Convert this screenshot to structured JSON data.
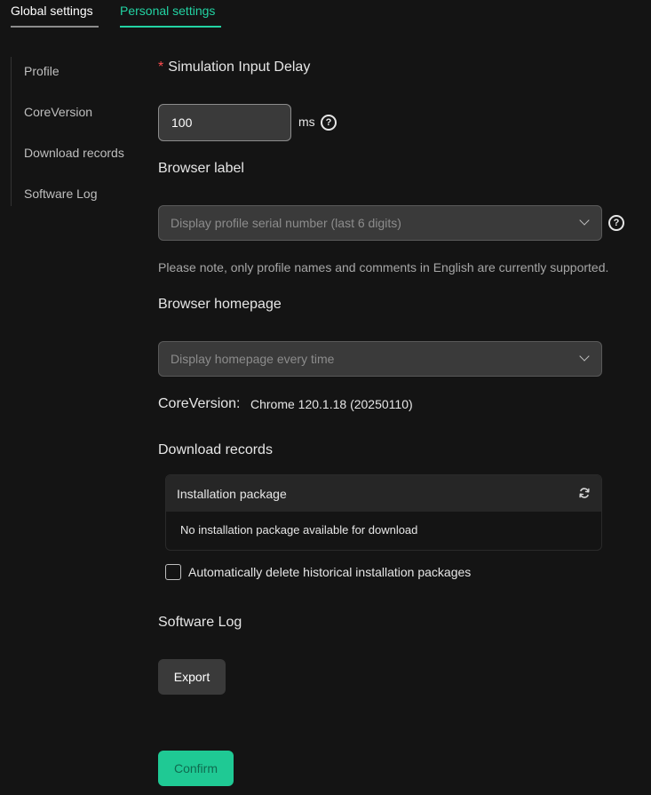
{
  "tabs": {
    "global": "Global settings",
    "personal": "Personal settings",
    "active": "personal"
  },
  "sidebar": {
    "items": [
      {
        "label": "Profile"
      },
      {
        "label": "CoreVersion"
      },
      {
        "label": "Download records"
      },
      {
        "label": "Software Log"
      }
    ]
  },
  "profile": {
    "simulation_delay": {
      "required_mark": "*",
      "label": "Simulation Input Delay",
      "value": "100",
      "unit": "ms"
    },
    "browser_label": {
      "label": "Browser label",
      "selected": "Display profile serial number (last 6 digits)"
    },
    "note": "Please note, only profile names and comments in English are currently supported.",
    "browser_homepage": {
      "label": "Browser homepage",
      "selected": "Display homepage every time"
    }
  },
  "core_version": {
    "label": "CoreVersion:",
    "value": "Chrome 120.1.18 (20250110)"
  },
  "download_records": {
    "title": "Download records",
    "table_header": "Installation package",
    "empty_text": "No installation package available for download",
    "auto_delete_label": "Automatically delete historical installation packages",
    "auto_delete_checked": false
  },
  "software_log": {
    "title": "Software Log",
    "export_label": "Export"
  },
  "confirm_label": "Confirm",
  "icons": {
    "help": "help-icon",
    "chevron": "chevron-down-icon",
    "refresh": "refresh-icon"
  },
  "colors": {
    "accent": "#22d3a3",
    "background": "#141414",
    "required": "#ff4d4f",
    "confirm_button": "#1fc994"
  }
}
